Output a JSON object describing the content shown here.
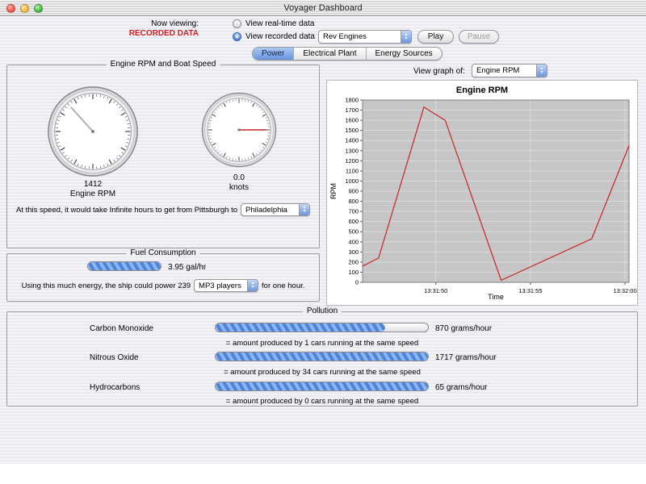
{
  "window": {
    "title": "Voyager Dashboard"
  },
  "viewing": {
    "label": "Now viewing:",
    "value": "RECORDED DATA",
    "value_color": "#cc2222",
    "realtime_option": "View real-time data",
    "recorded_option": "View recorded data",
    "recorded_selection": "Rev Engines",
    "play": "Play",
    "pause": "Pause"
  },
  "tabs": [
    {
      "label": "Power",
      "active": true
    },
    {
      "label": "Electrical Plant",
      "active": false
    },
    {
      "label": "Energy Sources",
      "active": false
    }
  ],
  "gauge_panel": {
    "title": "Engine RPM and Boat Speed",
    "rpm": {
      "value": "1412",
      "label": "Engine RPM",
      "needle_deg": -42,
      "needle_color": "#a8a8a8"
    },
    "speed": {
      "value": "0.0",
      "label": "knots",
      "needle_deg": 90,
      "needle_color": "#cc2222"
    },
    "trip_text": "At this speed, it would take Infinite hours to get from Pittsburgh to",
    "destination": "Philadelphia"
  },
  "fuel_panel": {
    "title": "Fuel Consumption",
    "bar_pct": 100,
    "rate": "3.95 gal/hr",
    "sentence_start": "Using this much energy, the ship could power 239",
    "device": "MP3 players",
    "sentence_end": "for one hour."
  },
  "graph_panel": {
    "view_label": "View graph of:",
    "selection": "Engine RPM"
  },
  "chart_data": {
    "type": "line",
    "title": "Engine RPM",
    "xlabel": "Time",
    "ylabel": "RPM",
    "ylim": [
      0,
      1800
    ],
    "y_tick_step": 100,
    "plot_bg": "#c6c6c6",
    "grid": true,
    "x_ticks": [
      {
        "pos": 0.275,
        "label": "13:31:50"
      },
      {
        "pos": 0.63,
        "label": "13:31:55"
      },
      {
        "pos": 0.985,
        "label": "13:32:00"
      }
    ],
    "series": [
      {
        "name": "Engine RPM",
        "color": "#cc2222",
        "points": [
          [
            0.0,
            160
          ],
          [
            0.06,
            240
          ],
          [
            0.23,
            1730
          ],
          [
            0.31,
            1600
          ],
          [
            0.52,
            20
          ],
          [
            0.86,
            430
          ],
          [
            1.0,
            1350
          ]
        ]
      }
    ]
  },
  "pollution_panel": {
    "title": "Pollution",
    "rows": [
      {
        "label": "Carbon Monoxide",
        "bar_pct": 80,
        "value": "870 grams/hour",
        "note": "= amount produced by 1 cars running at the same speed"
      },
      {
        "label": "Nitrous Oxide",
        "bar_pct": 100,
        "value": "1717 grams/hour",
        "note": "= amount produced by 34 cars running at the same speed"
      },
      {
        "label": "Hydrocarbons",
        "bar_pct": 100,
        "value": "65 grams/hour",
        "note": "= amount produced by 0 cars running at the same speed"
      }
    ]
  }
}
